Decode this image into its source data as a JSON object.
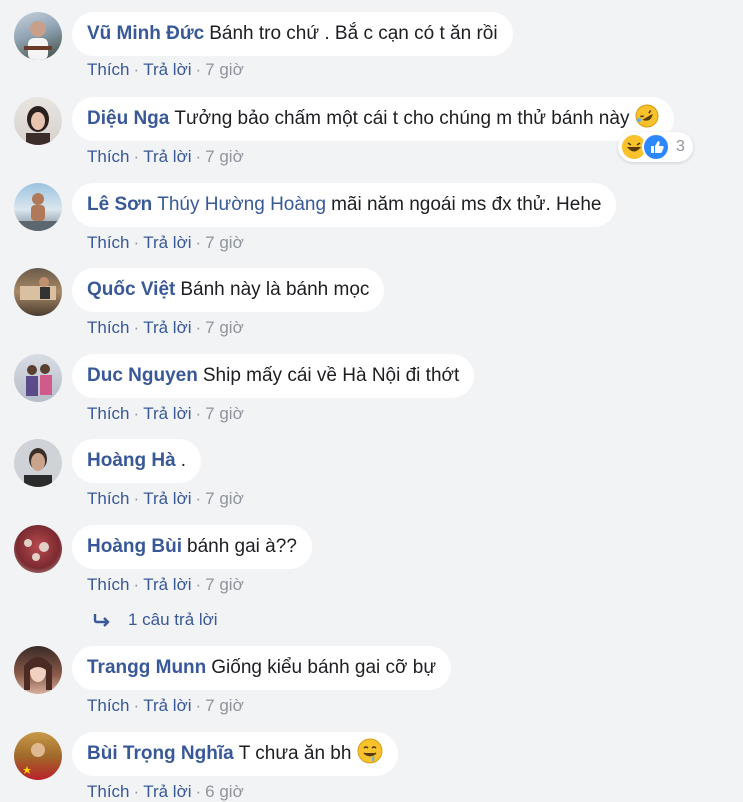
{
  "comments": [
    {
      "author": "Vũ Minh Đức",
      "text": "Bánh tro chứ . Bắ c cạn có t ăn rồi",
      "like": "Thích",
      "reply": "Trả lời",
      "time": "7 giờ"
    },
    {
      "author": "Diệu Nga",
      "text": "Tưởng bảo chấm một cái t cho chúng m thử bánh này",
      "like": "Thích",
      "reply": "Trả lời",
      "time": "7 giờ",
      "emoji": "rolling-on-floor-laughing-emoji",
      "reactions": {
        "count": "3",
        "types": [
          "haha",
          "like"
        ]
      }
    },
    {
      "author": "Lê Sơn",
      "mention": "Thúy Hường Hoàng",
      "text": "mãi năm ngoái ms đx thử. Hehe",
      "like": "Thích",
      "reply": "Trả lời",
      "time": "7 giờ"
    },
    {
      "author": "Quốc Việt",
      "text": "Bánh này là bánh mọc",
      "like": "Thích",
      "reply": "Trả lời",
      "time": "7 giờ"
    },
    {
      "author": "Duc Nguyen",
      "text": "Ship mấy cái về Hà Nội đi thớt",
      "like": "Thích",
      "reply": "Trả lời",
      "time": "7 giờ"
    },
    {
      "author": "Hoàng Hà",
      "text": ".",
      "like": "Thích",
      "reply": "Trả lời",
      "time": "7 giờ"
    },
    {
      "author": "Hoàng Bùi",
      "text": "bánh gai à??",
      "like": "Thích",
      "reply": "Trả lời",
      "time": "7 giờ",
      "replies_link": "1 câu trả lời"
    },
    {
      "author": "Trangg Munn",
      "text": "Giống kiểu bánh gai cỡ bự",
      "like": "Thích",
      "reply": "Trả lời",
      "time": "7 giờ"
    },
    {
      "author": "Bùi Trọng Nghĩa",
      "text": "T chưa ăn bh",
      "like": "Thích",
      "reply": "Trả lời",
      "time": "6 giờ",
      "emoji": "drooling-face-emoji"
    }
  ],
  "colors": {
    "background": "#f2f3f5",
    "link": "#385898",
    "meta": "#90949c",
    "bubble": "#ffffff"
  }
}
